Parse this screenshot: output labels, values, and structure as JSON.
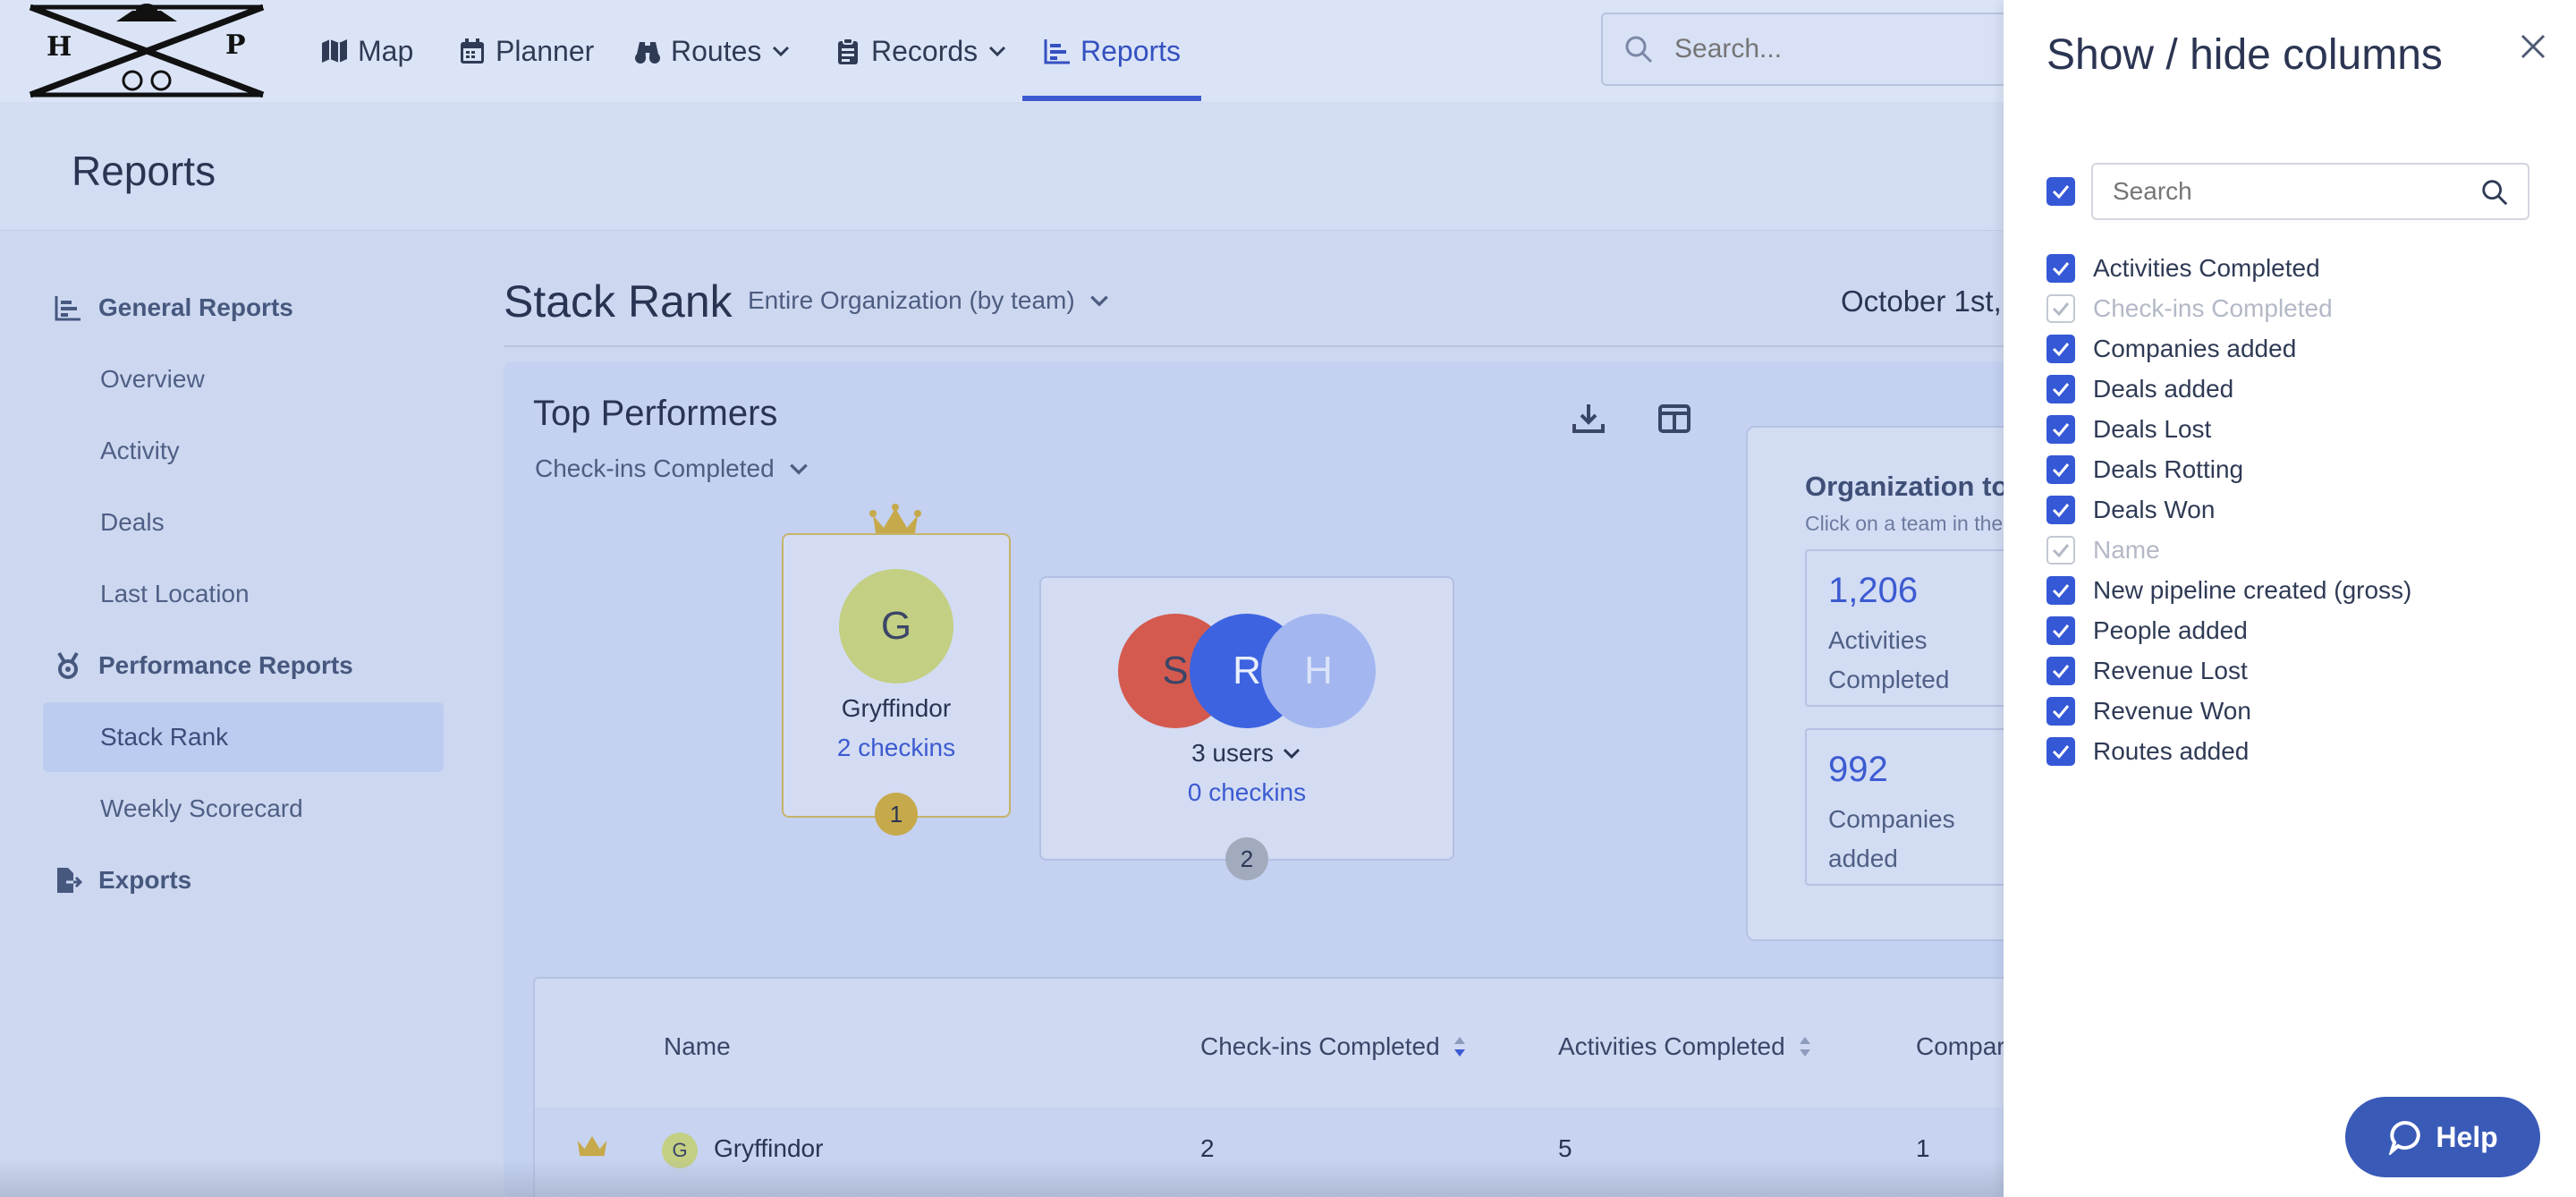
{
  "nav": {
    "items": [
      {
        "label": "Map",
        "icon": "map-icon"
      },
      {
        "label": "Planner",
        "icon": "calendar-icon"
      },
      {
        "label": "Routes",
        "icon": "binoculars-icon"
      },
      {
        "label": "Records",
        "icon": "clipboard-icon"
      },
      {
        "label": "Reports",
        "icon": "chart-icon"
      }
    ],
    "search_placeholder": "Search..."
  },
  "page": {
    "title": "Reports"
  },
  "sidebar": {
    "general_reports": "General Reports",
    "overview": "Overview",
    "activity": "Activity",
    "deals": "Deals",
    "last_location": "Last Location",
    "performance_reports": "Performance Reports",
    "stack_rank": "Stack Rank",
    "weekly_scorecard": "Weekly Scorecard",
    "exports": "Exports"
  },
  "main": {
    "title": "Stack Rank",
    "org_select": "Entire Organization (by team)",
    "date": "October 1st,",
    "top_performers": "Top Performers",
    "metric": "Check-ins Completed",
    "podium": [
      {
        "initial": "G",
        "name": "Gryffindor",
        "value": "2 checkins",
        "rank": "1"
      },
      {
        "initials": [
          "S",
          "R",
          "H"
        ],
        "name": "3 users",
        "value": "0 checkins",
        "rank": "2"
      }
    ],
    "org_totals": {
      "title": "Organization to",
      "subtitle": "Click on a team in the",
      "stats": [
        {
          "value": "1,206",
          "label": "Activities Completed"
        },
        {
          "value": "992",
          "label": "Companies added"
        }
      ]
    },
    "table": {
      "headers": [
        "Name",
        "Check-ins Completed",
        "Activities Completed",
        "Compar"
      ],
      "rows": [
        {
          "name": "Gryffindor",
          "initial": "G",
          "checkins": "2",
          "activities": "5",
          "companies": "1"
        }
      ]
    }
  },
  "drawer": {
    "title": "Show / hide columns",
    "search_placeholder": "Search",
    "columns": [
      {
        "label": "Activities Completed",
        "checked": true,
        "disabled": false
      },
      {
        "label": "Check-ins Completed",
        "checked": true,
        "disabled": true
      },
      {
        "label": "Companies added",
        "checked": true,
        "disabled": false
      },
      {
        "label": "Deals added",
        "checked": true,
        "disabled": false
      },
      {
        "label": "Deals Lost",
        "checked": true,
        "disabled": false
      },
      {
        "label": "Deals Rotting",
        "checked": true,
        "disabled": false
      },
      {
        "label": "Deals Won",
        "checked": true,
        "disabled": false
      },
      {
        "label": "Name",
        "checked": true,
        "disabled": true
      },
      {
        "label": "New pipeline created (gross)",
        "checked": true,
        "disabled": false
      },
      {
        "label": "People added",
        "checked": true,
        "disabled": false
      },
      {
        "label": "Revenue Lost",
        "checked": true,
        "disabled": false
      },
      {
        "label": "Revenue Won",
        "checked": true,
        "disabled": false
      },
      {
        "label": "Routes added",
        "checked": true,
        "disabled": false
      }
    ]
  },
  "help": {
    "label": "Help"
  },
  "colors": {
    "accent": "#3558d6",
    "gold": "#c6b36a",
    "avatar_g": "#c3cf82",
    "avatar_s": "#d45a4f",
    "avatar_r": "#3d63e0",
    "avatar_h": "#a3b6f0"
  }
}
